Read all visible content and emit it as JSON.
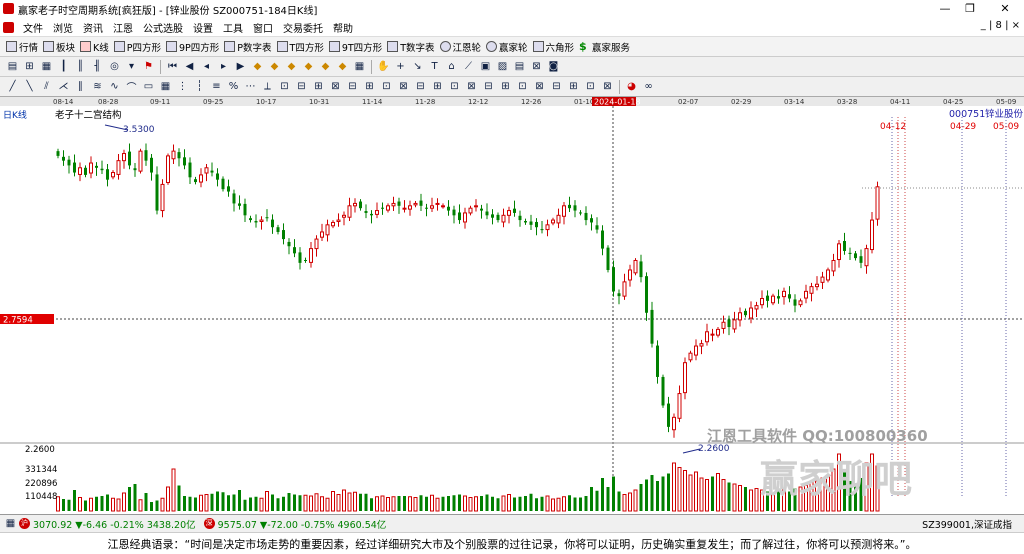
{
  "window": {
    "title": "赢家老子时空周期系统[疯狂版] - [锌业股份  SZ000751-184日K线]",
    "btn_min": "—",
    "btn_max": "❐",
    "btn_close": "✕"
  },
  "menu": {
    "items": [
      "文件",
      "浏览",
      "资讯",
      "江恩",
      "公式选股",
      "设置",
      "工具",
      "窗口",
      "交易委托",
      "帮助"
    ],
    "mdi": "_ | 8 | ×"
  },
  "toolbar1": {
    "items": [
      "行情",
      "板块",
      "K线",
      "P四方形",
      "9P四方形",
      "P数字表",
      "T四方形",
      "9T四方形",
      "T数字表",
      "江恩轮",
      "赢家轮",
      "六角形",
      "赢家服务"
    ]
  },
  "chart": {
    "period_label": "日K线",
    "dates": [
      "08-14",
      "08-28",
      "09-11",
      "09-25",
      "10-17",
      "10-31",
      "11-14",
      "11-28",
      "12-12",
      "12-26",
      "01-10",
      "2024-01-18",
      "02-07",
      "02-29",
      "03-14",
      "03-28",
      "04-11",
      "04-25",
      "05-09"
    ],
    "annotation": "老子十二宫结构",
    "high_price": "3.5300",
    "low_price": "2.2600",
    "stock_code": "000751",
    "stock_name": "锌业股份",
    "future_dates": [
      "04-12",
      "04-29",
      "05-09"
    ],
    "price_marker": "2.7594",
    "vol_ticks": [
      "2.2600",
      "331344",
      "220896",
      "110448"
    ],
    "watermark1": "江恩工具软件  QQ:100800360",
    "watermark2": "赢家聊吧"
  },
  "chart_data": {
    "type": "candlestick",
    "ylim": [
      2.2,
      3.58
    ],
    "cursor_date": "2024-01-18",
    "closes": [
      3.45,
      3.43,
      3.41,
      3.38,
      3.4,
      3.37,
      3.42,
      3.4,
      3.39,
      3.35,
      3.38,
      3.43,
      3.46,
      3.41,
      3.39,
      3.47,
      3.43,
      3.38,
      3.22,
      3.33,
      3.45,
      3.47,
      3.44,
      3.41,
      3.36,
      3.34,
      3.37,
      3.4,
      3.38,
      3.35,
      3.31,
      3.3,
      3.25,
      3.24,
      3.2,
      3.18,
      3.17,
      3.18,
      3.19,
      3.15,
      3.13,
      3.1,
      3.07,
      3.04,
      3.0,
      3.01,
      3.06,
      3.1,
      3.13,
      3.16,
      3.17,
      3.18,
      3.2,
      3.24,
      3.25,
      3.23,
      3.21,
      3.2,
      3.22,
      3.23,
      3.24,
      3.25,
      3.24,
      3.23,
      3.24,
      3.25,
      3.24,
      3.23,
      3.24,
      3.25,
      3.24,
      3.22,
      3.2,
      3.18,
      3.21,
      3.23,
      3.24,
      3.22,
      3.2,
      3.19,
      3.18,
      3.2,
      3.22,
      3.21,
      3.18,
      3.17,
      3.16,
      3.15,
      3.14,
      3.16,
      3.18,
      3.2,
      3.24,
      3.23,
      3.22,
      3.21,
      3.18,
      3.17,
      3.14,
      3.06,
      2.97,
      2.88,
      2.86,
      2.92,
      2.97,
      3.01,
      2.94,
      2.79,
      2.66,
      2.52,
      2.4,
      2.31,
      2.35,
      2.45,
      2.58,
      2.62,
      2.65,
      2.66,
      2.71,
      2.7,
      2.72,
      2.75,
      2.73,
      2.76,
      2.79,
      2.78,
      2.81,
      2.82,
      2.85,
      2.84,
      2.86,
      2.85,
      2.88,
      2.85,
      2.82,
      2.84,
      2.88,
      2.9,
      2.91,
      2.94,
      2.97,
      3.01,
      3.08,
      3.05,
      3.04,
      3.02,
      3.0,
      3.06,
      3.18,
      3.32
    ],
    "volumes": [
      95,
      80,
      75,
      140,
      90,
      70,
      85,
      95,
      100,
      110,
      85,
      80,
      120,
      160,
      180,
      75,
      120,
      60,
      70,
      85,
      160,
      280,
      170,
      100,
      95,
      90,
      105,
      110,
      115,
      130,
      125,
      105,
      110,
      140,
      75,
      90,
      95,
      85,
      130,
      110,
      85,
      95,
      120,
      110,
      105,
      105,
      100,
      115,
      95,
      85,
      130,
      110,
      140,
      120,
      125,
      115,
      115,
      85,
      95,
      100,
      90,
      95,
      100,
      100,
      95,
      90,
      105,
      95,
      105,
      85,
      95,
      100,
      105,
      110,
      100,
      90,
      95,
      100,
      110,
      95,
      85,
      100,
      110,
      90,
      95,
      100,
      115,
      85,
      95,
      100,
      80,
      85,
      95,
      105,
      90,
      90,
      100,
      160,
      135,
      220,
      160,
      230,
      130,
      110,
      120,
      140,
      180,
      210,
      240,
      200,
      230,
      250,
      320,
      290,
      270,
      240,
      260,
      220,
      210,
      230,
      250,
      210,
      190,
      180,
      170,
      160,
      140,
      150,
      140,
      130,
      120,
      150,
      140,
      130,
      150,
      160,
      170,
      190,
      200,
      220,
      240,
      280,
      380,
      260,
      200,
      180,
      220,
      320,
      380,
      300
    ]
  },
  "status": {
    "sh": "3070.92 ▼-6.46 -0.21% 3438.20亿",
    "sz": "9575.07 ▼-72.00 -0.75% 4960.54亿",
    "right": "SZ399001,深证成指"
  },
  "quote": "江恩经典语录：“时间是决定市场走势的重要因素，经过详细研究大市及个别股票的过往记录，你将可以证明，历史确实重复发生；而了解过往，你将可以预测将来。”。",
  "colors": {
    "up": "#d00000",
    "down": "#008000",
    "bg": "#ffffff",
    "marker": "#e00000"
  }
}
